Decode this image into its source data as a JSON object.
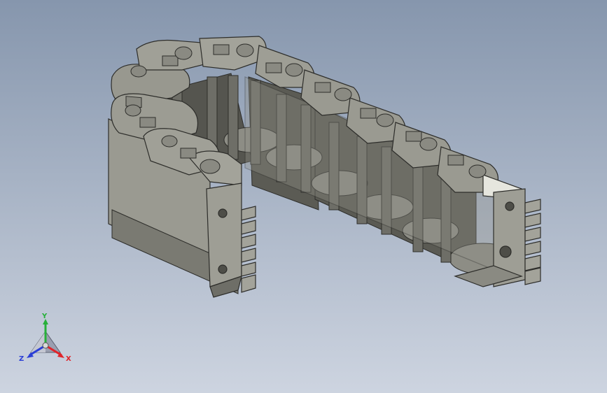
{
  "viewport": {
    "background_top": "#8696ad",
    "background_bottom": "#cdd4e0",
    "model_face_color": "#8b8b82",
    "model_dark_color": "#5f5f58",
    "model_light_color": "#b0b0a6",
    "edge_color": "#2d2d2a",
    "highlight_color": "#e6e6de"
  },
  "triad": {
    "x_label": "X",
    "y_label": "Y",
    "z_label": "Z",
    "x_color": "#e0242a",
    "y_color": "#27b03a",
    "z_color": "#2b3fd6"
  }
}
